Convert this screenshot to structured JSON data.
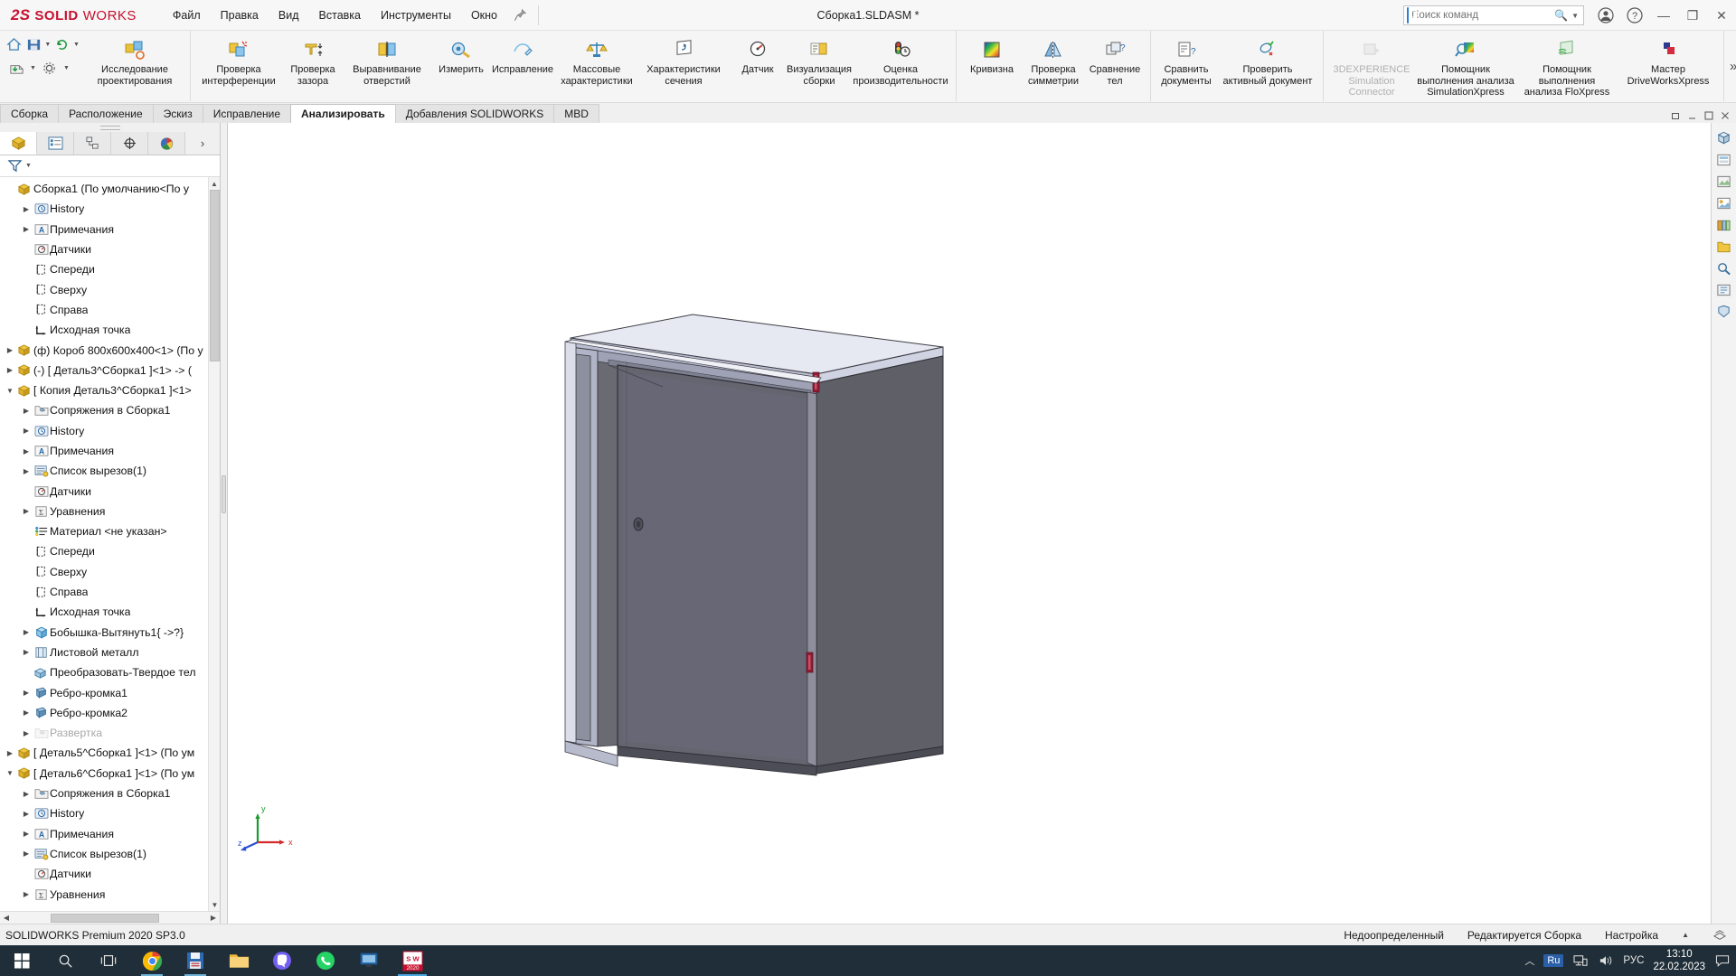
{
  "titlebar": {
    "brand_ds": "2S",
    "brand_solid": "SOLID",
    "brand_works": "WORKS",
    "menu": [
      {
        "label": "Файл"
      },
      {
        "label": "Правка"
      },
      {
        "label": "Вид"
      },
      {
        "label": "Вставка"
      },
      {
        "label": "Инструменты"
      },
      {
        "label": "Окно"
      }
    ],
    "document_title": "Сборка1.SLDASM *",
    "search_placeholder": "Поиск команд",
    "window_buttons": {
      "minimize": "—",
      "restore": "❐",
      "close": "✕"
    }
  },
  "ribbon": {
    "quick_access": [
      "home-icon",
      "save-icon",
      "undo-icon",
      "print-icon",
      "options-icon"
    ],
    "groups": [
      {
        "items": [
          {
            "label": "Исследование\nпроектирования",
            "icon": "design-study-icon",
            "disabled": false,
            "width": "xwide"
          }
        ]
      },
      {
        "items": [
          {
            "label": "Проверка\nинтерференции",
            "icon": "interference-check-icon",
            "disabled": false,
            "width": "wide"
          },
          {
            "label": "Проверка\nзазора",
            "icon": "clearance-check-icon",
            "disabled": false,
            "width": "normal"
          },
          {
            "label": "Выравнивание\nотверстий",
            "icon": "hole-align-icon",
            "disabled": false,
            "width": "wide"
          },
          {
            "label": "Измерить",
            "icon": "measure-icon",
            "disabled": false,
            "width": "normal"
          },
          {
            "label": "Исправление",
            "icon": "repair-icon",
            "disabled": false,
            "width": "normal"
          },
          {
            "label": "Массовые\nхарактеристики",
            "icon": "mass-properties-icon",
            "disabled": false,
            "width": "wide"
          },
          {
            "label": "Характеристики\nсечения",
            "icon": "section-properties-icon",
            "disabled": false,
            "width": "wide"
          },
          {
            "label": "Датчик",
            "icon": "sensor-icon",
            "disabled": false,
            "width": "normal"
          },
          {
            "label": "Визуализация\nсборки",
            "icon": "assembly-visualization-icon",
            "disabled": false,
            "width": "normal"
          },
          {
            "label": "Оценка\nпроизводительности",
            "icon": "performance-evaluation-icon",
            "disabled": false,
            "width": "xwide"
          }
        ]
      },
      {
        "items": [
          {
            "label": "Кривизна",
            "icon": "curvature-icon",
            "disabled": false,
            "width": "normal"
          },
          {
            "label": "Проверка\nсимметрии",
            "icon": "symmetry-check-icon",
            "disabled": false,
            "width": "normal"
          },
          {
            "label": "Сравнение\nтел",
            "icon": "compare-bodies-icon",
            "disabled": false,
            "width": "normal"
          }
        ]
      },
      {
        "items": [
          {
            "label": "Сравнить\nдокументы",
            "icon": "compare-documents-icon",
            "disabled": false,
            "width": "normal"
          },
          {
            "label": "Проверить\nактивный документ",
            "icon": "check-active-document-icon",
            "disabled": false,
            "width": "xwide"
          }
        ]
      },
      {
        "items": [
          {
            "label": "3DEXPERIENCE\nSimulation\nConnector",
            "icon": "3dexperience-simulation-icon",
            "disabled": true,
            "width": "wide"
          },
          {
            "label": "Помощник\nвыполнения анализа\nSimulationXpress",
            "icon": "simulationxpress-icon",
            "disabled": false,
            "width": "xwide"
          },
          {
            "label": "Помощник\nвыполнения\nанализа FloXpress",
            "icon": "floxpress-icon",
            "disabled": false,
            "width": "xwide"
          },
          {
            "label": "Мастер\nDriveWorksXpress",
            "icon": "driveworksxpress-icon",
            "disabled": false,
            "width": "xwide"
          }
        ]
      }
    ],
    "overflow": "»"
  },
  "command_tabs": {
    "tabs": [
      {
        "label": "Сборка",
        "active": false
      },
      {
        "label": "Расположение",
        "active": false
      },
      {
        "label": "Эскиз",
        "active": false
      },
      {
        "label": "Исправление",
        "active": false
      },
      {
        "label": "Анализировать",
        "active": true
      },
      {
        "label": "Добавления SOLIDWORKS",
        "active": false
      },
      {
        "label": "MBD",
        "active": false
      }
    ],
    "window_controls": [
      "restore-down-icon",
      "minimize-icon",
      "maximize-icon",
      "close-icon"
    ]
  },
  "tree_panel": {
    "tabs": [
      {
        "name": "feature-manager-tab",
        "active": true
      },
      {
        "name": "property-manager-tab",
        "active": false
      },
      {
        "name": "configuration-manager-tab",
        "active": false
      },
      {
        "name": "dimxpert-manager-tab",
        "active": false
      },
      {
        "name": "display-manager-tab",
        "active": false
      }
    ],
    "filter_icon": "filter-icon",
    "items": [
      {
        "label": "Сборка1  (По умолчанию<По у",
        "indent": 0,
        "arrow": "",
        "icon": "assembly-icon",
        "dim": false,
        "root": true
      },
      {
        "label": "History",
        "indent": 1,
        "arrow": "▶",
        "icon": "history-icon",
        "dim": false
      },
      {
        "label": "Примечания",
        "indent": 1,
        "arrow": "▶",
        "icon": "annotations-icon",
        "dim": false
      },
      {
        "label": "Датчики",
        "indent": 1,
        "arrow": "",
        "icon": "sensors-icon",
        "dim": false
      },
      {
        "label": "Спереди",
        "indent": 1,
        "arrow": "",
        "icon": "plane-icon",
        "dim": false
      },
      {
        "label": "Сверху",
        "indent": 1,
        "arrow": "",
        "icon": "plane-icon",
        "dim": false
      },
      {
        "label": "Справа",
        "indent": 1,
        "arrow": "",
        "icon": "plane-icon",
        "dim": false
      },
      {
        "label": "Исходная точка",
        "indent": 1,
        "arrow": "",
        "icon": "origin-icon",
        "dim": false
      },
      {
        "label": "(ф) Короб 800x600x400<1>  (По у",
        "indent": 0,
        "arrow": "▶",
        "icon": "part-icon",
        "dim": false
      },
      {
        "label": "(-) [ Деталь3^Сборка1 ]<1> -> (",
        "indent": 0,
        "arrow": "▶",
        "icon": "part-icon",
        "dim": false
      },
      {
        "label": "[ Копия Деталь3^Сборка1 ]<1>",
        "indent": 0,
        "arrow": "▼",
        "icon": "part-icon",
        "dim": false
      },
      {
        "label": "Сопряжения в Сборка1",
        "indent": 1,
        "arrow": "▶",
        "icon": "mates-folder-icon",
        "dim": false
      },
      {
        "label": "History",
        "indent": 1,
        "arrow": "▶",
        "icon": "history-icon",
        "dim": false
      },
      {
        "label": "Примечания",
        "indent": 1,
        "arrow": "▶",
        "icon": "annotations-icon",
        "dim": false
      },
      {
        "label": "Список вырезов(1)",
        "indent": 1,
        "arrow": "▶",
        "icon": "cutlist-icon",
        "dim": false
      },
      {
        "label": "Датчики",
        "indent": 1,
        "arrow": "",
        "icon": "sensors-icon",
        "dim": false
      },
      {
        "label": "Уравнения",
        "indent": 1,
        "arrow": "▶",
        "icon": "equations-icon",
        "dim": false
      },
      {
        "label": "Материал <не указан>",
        "indent": 1,
        "arrow": "",
        "icon": "material-icon",
        "dim": false
      },
      {
        "label": "Спереди",
        "indent": 1,
        "arrow": "",
        "icon": "plane-icon",
        "dim": false
      },
      {
        "label": "Сверху",
        "indent": 1,
        "arrow": "",
        "icon": "plane-icon",
        "dim": false
      },
      {
        "label": "Справа",
        "indent": 1,
        "arrow": "",
        "icon": "plane-icon",
        "dim": false
      },
      {
        "label": "Исходная точка",
        "indent": 1,
        "arrow": "",
        "icon": "origin-icon",
        "dim": false
      },
      {
        "label": "Бобышка-Вытянуть1{ ->?}",
        "indent": 1,
        "arrow": "▶",
        "icon": "boss-extrude-icon",
        "dim": false
      },
      {
        "label": "Листовой металл",
        "indent": 1,
        "arrow": "▶",
        "icon": "sheetmetal-icon",
        "dim": false
      },
      {
        "label": "Преобразовать-Твердое тел",
        "indent": 1,
        "arrow": "",
        "icon": "convert-solid-icon",
        "dim": false
      },
      {
        "label": "Ребро-кромка1",
        "indent": 1,
        "arrow": "▶",
        "icon": "edge-flange-icon",
        "dim": false
      },
      {
        "label": "Ребро-кромка2",
        "indent": 1,
        "arrow": "▶",
        "icon": "edge-flange-icon",
        "dim": false
      },
      {
        "label": "Развертка",
        "indent": 1,
        "arrow": "▶",
        "icon": "flat-pattern-icon",
        "dim": true
      },
      {
        "label": "[ Деталь5^Сборка1 ]<1>  (По ум",
        "indent": 0,
        "arrow": "▶",
        "icon": "part-icon",
        "dim": false
      },
      {
        "label": "[ Деталь6^Сборка1 ]<1>  (По ум",
        "indent": 0,
        "arrow": "▼",
        "icon": "part-icon",
        "dim": false
      },
      {
        "label": "Сопряжения в Сборка1",
        "indent": 1,
        "arrow": "▶",
        "icon": "mates-folder-icon",
        "dim": false
      },
      {
        "label": "History",
        "indent": 1,
        "arrow": "▶",
        "icon": "history-icon",
        "dim": false
      },
      {
        "label": "Примечания",
        "indent": 1,
        "arrow": "▶",
        "icon": "annotations-icon",
        "dim": false
      },
      {
        "label": "Список вырезов(1)",
        "indent": 1,
        "arrow": "▶",
        "icon": "cutlist-icon",
        "dim": false
      },
      {
        "label": "Датчики",
        "indent": 1,
        "arrow": "",
        "icon": "sensors-icon",
        "dim": false
      },
      {
        "label": "Уравнения",
        "indent": 1,
        "arrow": "▶",
        "icon": "equations-icon",
        "dim": false
      }
    ]
  },
  "viewport": {
    "hud_tools": [
      "zoom-to-fit-icon",
      "zoom-to-area-icon",
      "previous-view-icon",
      "section-view-icon",
      "view-orientation-icon",
      "display-style-icon",
      "hide-show-icon",
      "appearances-icon",
      "scene-icon",
      "viewport-layout-icon"
    ],
    "triad": {
      "x": "x",
      "y": "y",
      "z": "z"
    }
  },
  "right_strip": {
    "icons": [
      "view-palette-icon",
      "appearances-library-icon",
      "scenes-icon",
      "decals-icon",
      "design-library-icon",
      "file-explorer-icon",
      "search-library-icon",
      "view-palette2-icon",
      "custom-properties-icon"
    ]
  },
  "statusbar": {
    "left": "SOLIDWORKS Premium 2020 SP3.0",
    "state": "Недоопределенный",
    "edit_mode": "Редактируется Сборка",
    "settings": "Настройка",
    "caret": "▲"
  },
  "taskbar": {
    "apps": [
      {
        "name": "start-button"
      },
      {
        "name": "search-button"
      },
      {
        "name": "task-view-button"
      },
      {
        "name": "chrome-taskbar-icon"
      },
      {
        "name": "save-app-taskbar-icon"
      },
      {
        "name": "file-explorer-taskbar-icon"
      },
      {
        "name": "viber-taskbar-icon"
      },
      {
        "name": "whatsapp-taskbar-icon"
      },
      {
        "name": "remote-desktop-taskbar-icon"
      },
      {
        "name": "solidworks-taskbar-icon"
      }
    ],
    "tray": {
      "chevron": "︿",
      "lang_badge": "Ru",
      "language": "РУС",
      "time": "13:10",
      "date": "22.02.2023"
    },
    "solidworks_badge": "2020"
  },
  "colors": {
    "brand_red": "#c8102e",
    "accent_blue": "#2f7fd1",
    "taskbar_bg": "#1f2e38",
    "ribbon_bg": "#f5f5f5",
    "model_face_dark": "#616168",
    "model_face_light": "#c7cbdd",
    "handle_red": "#8e1d34"
  }
}
